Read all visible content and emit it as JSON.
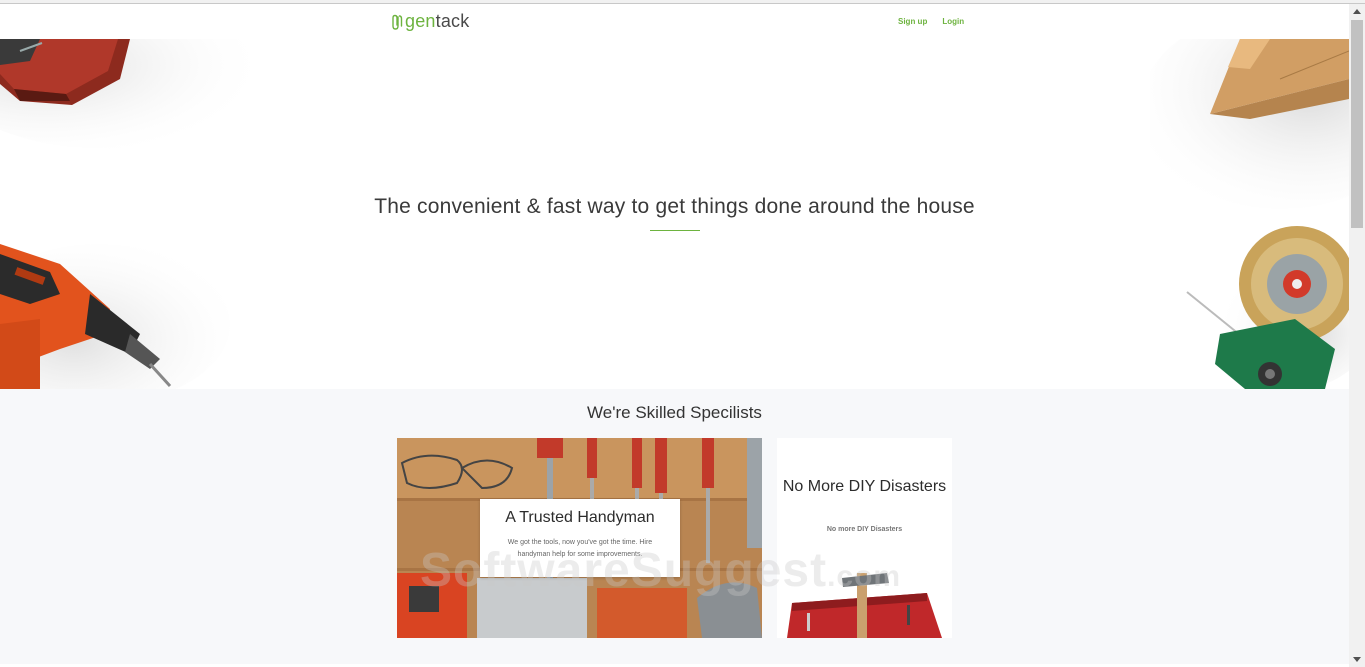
{
  "brand": {
    "logo_prefix": "gen",
    "logo_suffix": "tack",
    "accent_color": "#6db33f"
  },
  "nav": {
    "signup_label": "Sign up",
    "login_label": "Login"
  },
  "hero": {
    "title": "The convenient & fast way to get things done around the house"
  },
  "specialists": {
    "title": "We're Skilled Specilists",
    "cards": [
      {
        "title": "A Trusted Handyman",
        "text": "We got the tools, now you've got the time. Hire handyman help for some improvements."
      },
      {
        "title": "No More DIY Disasters",
        "text": "No more DIY Disasters"
      }
    ]
  },
  "watermark": {
    "text": "SoftwareSuggest",
    "suffix": ".com"
  }
}
